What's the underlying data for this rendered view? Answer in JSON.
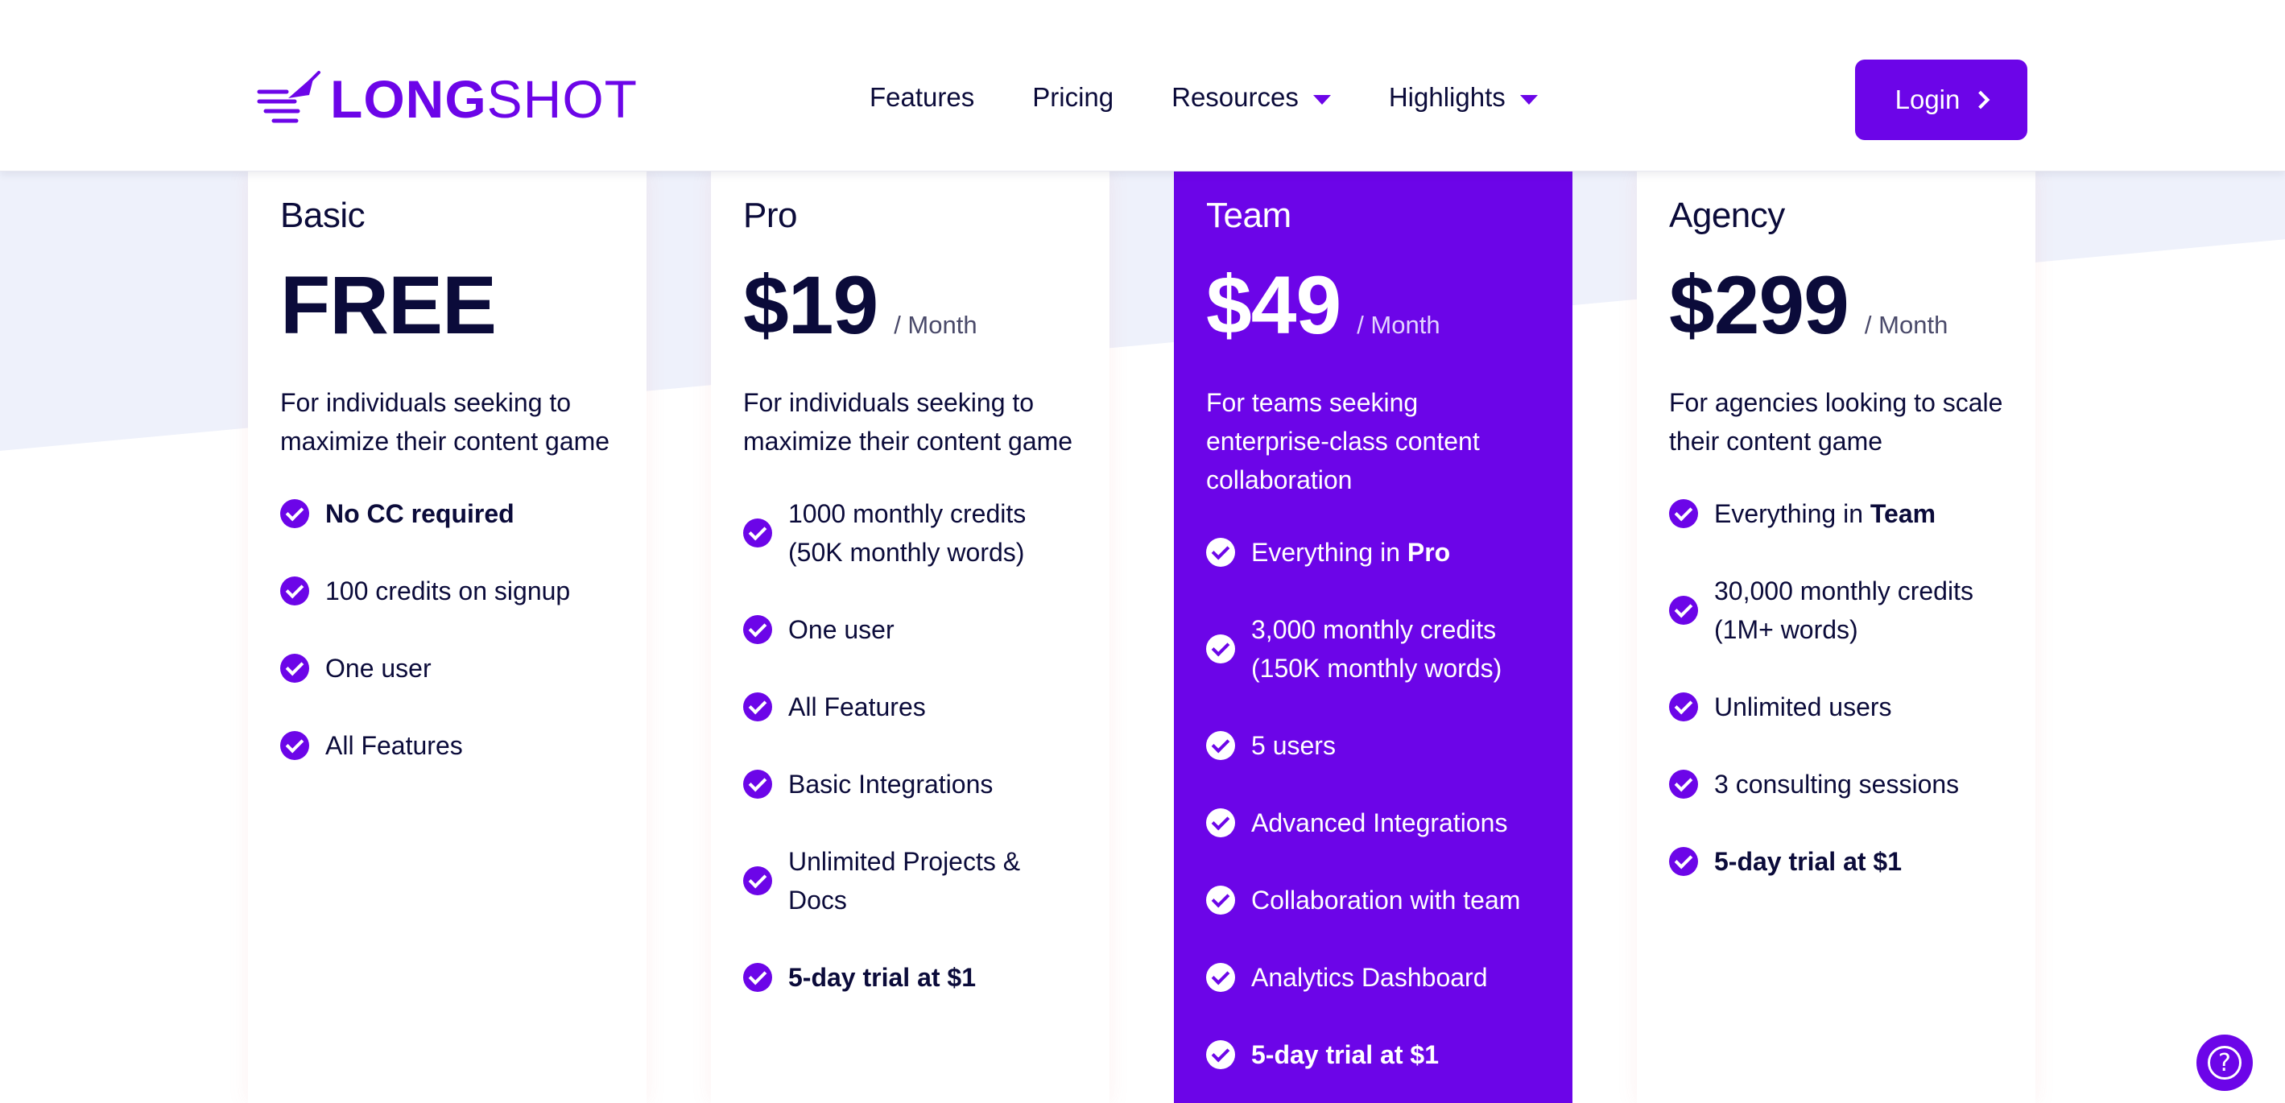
{
  "brand": {
    "logo_bold": "LONG",
    "logo_rest": "SHOT",
    "color": "#6c05e8"
  },
  "nav": {
    "items": [
      {
        "label": "Features",
        "dropdown": false
      },
      {
        "label": "Pricing",
        "dropdown": false
      },
      {
        "label": "Resources",
        "dropdown": true
      },
      {
        "label": "Highlights",
        "dropdown": true
      }
    ],
    "login": "Login"
  },
  "plans": [
    {
      "name": "Basic",
      "price": "FREE",
      "period": "",
      "description": "For individuals seeking to maximize their content game",
      "features": [
        {
          "pre": "",
          "bold": "No CC required",
          "post": ""
        },
        {
          "pre": "100 credits on signup",
          "bold": "",
          "post": ""
        },
        {
          "pre": "One user",
          "bold": "",
          "post": ""
        },
        {
          "pre": "All Features",
          "bold": "",
          "post": ""
        }
      ]
    },
    {
      "name": "Pro",
      "price": "$19",
      "period": "/ Month",
      "description": "For individuals seeking to maximize their content game",
      "features": [
        {
          "pre": "1000 monthly credits (50K monthly words)",
          "bold": "",
          "post": ""
        },
        {
          "pre": "One user",
          "bold": "",
          "post": ""
        },
        {
          "pre": "All Features",
          "bold": "",
          "post": ""
        },
        {
          "pre": "Basic Integrations",
          "bold": "",
          "post": ""
        },
        {
          "pre": "Unlimited Projects & Docs",
          "bold": "",
          "post": ""
        },
        {
          "pre": "",
          "bold": "5-day trial at $1",
          "post": ""
        }
      ]
    },
    {
      "name": "Team",
      "price": "$49",
      "period": "/ Month",
      "description": "For teams seeking enterprise-class content collaboration",
      "features": [
        {
          "pre": "Everything in ",
          "bold": "Pro",
          "post": ""
        },
        {
          "pre": "3,000 monthly credits (150K monthly words)",
          "bold": "",
          "post": ""
        },
        {
          "pre": "5 users",
          "bold": "",
          "post": ""
        },
        {
          "pre": "Advanced Integrations",
          "bold": "",
          "post": ""
        },
        {
          "pre": "Collaboration with team",
          "bold": "",
          "post": ""
        },
        {
          "pre": "Analytics Dashboard",
          "bold": "",
          "post": ""
        },
        {
          "pre": "",
          "bold": "5-day trial at $1",
          "post": ""
        }
      ]
    },
    {
      "name": "Agency",
      "price": "$299",
      "period": "/ Month",
      "description": "For agencies looking to scale their content game",
      "features": [
        {
          "pre": "Everything in ",
          "bold": "Team",
          "post": ""
        },
        {
          "pre": "30,000 monthly credits (1M+ words)",
          "bold": "",
          "post": ""
        },
        {
          "pre": "Unlimited users",
          "bold": "",
          "post": ""
        },
        {
          "pre": "3 consulting sessions",
          "bold": "",
          "post": ""
        },
        {
          "pre": "",
          "bold": "5-day trial at $1",
          "post": ""
        }
      ]
    }
  ],
  "help": {
    "icon": "question-circle-icon",
    "glyph": "?"
  }
}
